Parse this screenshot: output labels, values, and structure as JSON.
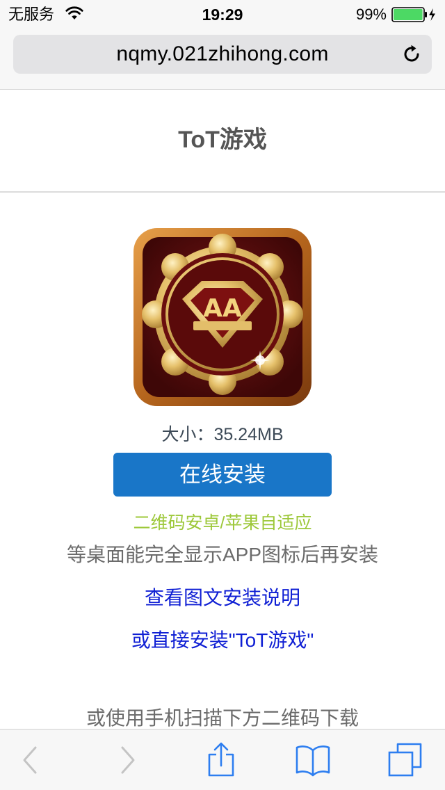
{
  "status_bar": {
    "carrier": "无服务",
    "time": "19:29",
    "battery_percent": "99%",
    "battery_level": 0.99,
    "icons": [
      "wifi-icon",
      "battery-icon"
    ]
  },
  "browser": {
    "url": "nqmy.021zhihong.com",
    "reload_icon": "reload-icon",
    "toolbar_icons": [
      "back-icon",
      "forward-icon",
      "share-icon",
      "bookmarks-icon",
      "tabs-icon"
    ]
  },
  "page": {
    "title": "ToT游戏",
    "app_icon": "game-app-icon",
    "size_label": "大小：35.24MB",
    "install_button": "在线安装",
    "qr_adapt_note": "二维码安卓/苹果自适应",
    "wait_note": "等桌面能完全显示APP图标后再安装",
    "guide_link": "查看图文安装说明",
    "direct_install_link": "或直接安装\"ToT游戏\"",
    "scan_note": "或使用手机扫描下方二维码下载"
  },
  "colors": {
    "accent_blue": "#1976c8",
    "link_blue": "#0f1fd4",
    "qr_note_green": "#9dc83a",
    "ios_tint": "#2d7ef0",
    "battery_green": "#4cd964"
  }
}
